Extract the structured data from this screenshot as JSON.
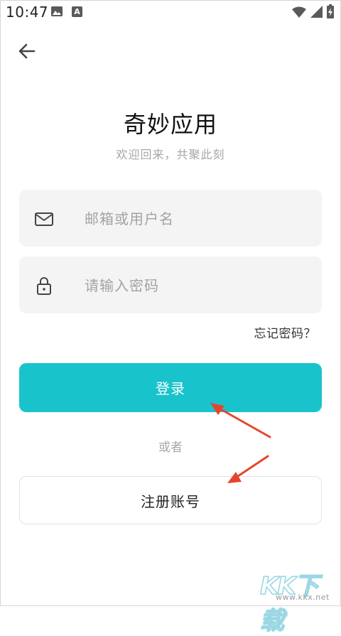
{
  "status_bar": {
    "time": "10:47",
    "icons": [
      "image-icon",
      "a-badge-icon",
      "wifi-icon",
      "signal-icon",
      "battery-icon"
    ],
    "a_badge_text": "A"
  },
  "header": {
    "back_icon": "arrow-left-icon"
  },
  "app": {
    "title": "奇妙应用",
    "subtitle": "欢迎回来，共聚此刻"
  },
  "form": {
    "email": {
      "icon": "mail-icon",
      "placeholder": "邮箱或用户名",
      "value": ""
    },
    "password": {
      "icon": "lock-icon",
      "placeholder": "请输入密码",
      "value": ""
    },
    "forgot_label": "忘记密码？",
    "login_label": "登录",
    "or_label": "或者",
    "register_label": "注册账号"
  },
  "watermark": {
    "logo_text": "KK下载",
    "url": "www.kkx.net"
  },
  "colors": {
    "accent": "#19c3cb",
    "field_bg": "#f4f4f4",
    "annotation_arrow": "#e5452e",
    "placeholder": "#a3a3a3"
  }
}
